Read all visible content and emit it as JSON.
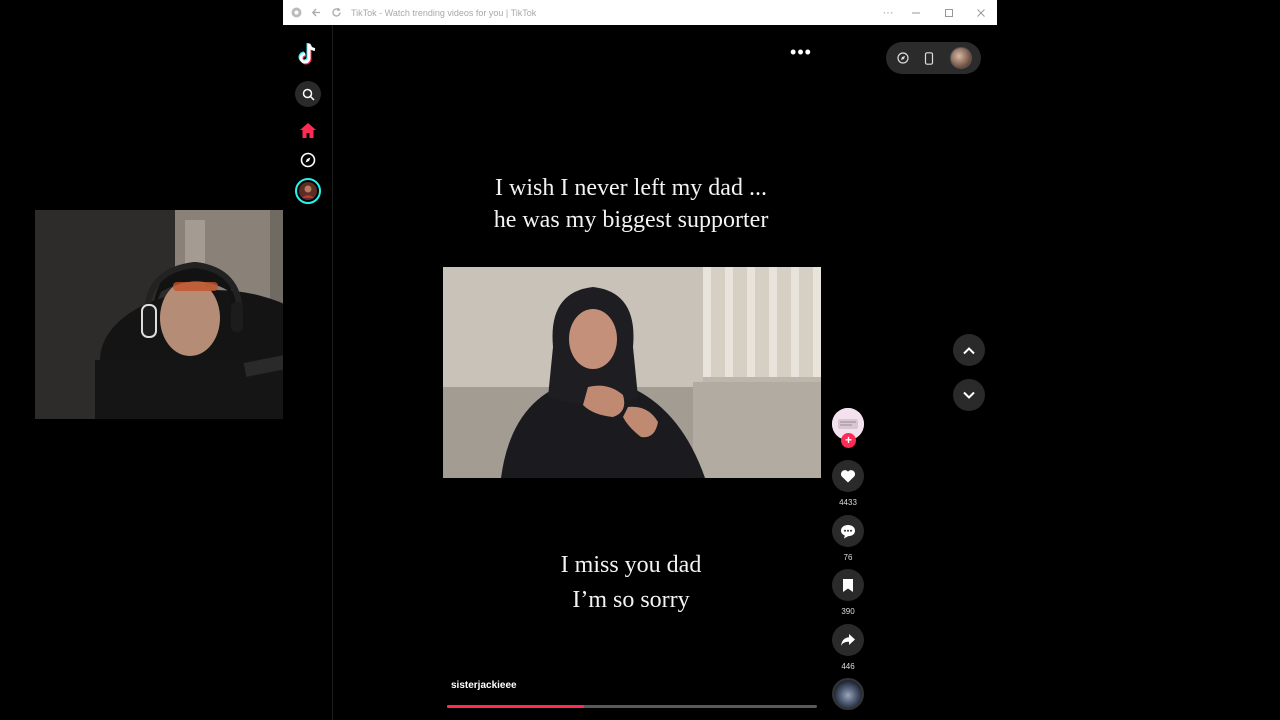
{
  "browser": {
    "title": "TikTok - Watch trending videos for you | TikTok"
  },
  "video": {
    "caption_top_line1": "I wish I never left my dad ...",
    "caption_top_line2": "he was my biggest supporter",
    "caption_bottom_line1": "I miss you dad",
    "caption_bottom_line2": "I’m so sorry",
    "username": "sisterjackieee",
    "progress": 0.37
  },
  "actions": {
    "likes": "4433",
    "comments": "76",
    "saves": "390",
    "shares": "446"
  },
  "colors": {
    "accent": "#fe2c55",
    "background": "#000000",
    "button_bg": "#2a2a2a"
  },
  "icons": {
    "logo": "tiktok-logo-icon",
    "search": "search-icon",
    "home": "home-icon",
    "explore": "compass-icon",
    "profile": "avatar",
    "more": "more-icon",
    "like": "heart-icon",
    "comment": "comment-icon",
    "save": "bookmark-icon",
    "share": "share-icon",
    "up": "chevron-up-icon",
    "down": "chevron-down-icon"
  }
}
